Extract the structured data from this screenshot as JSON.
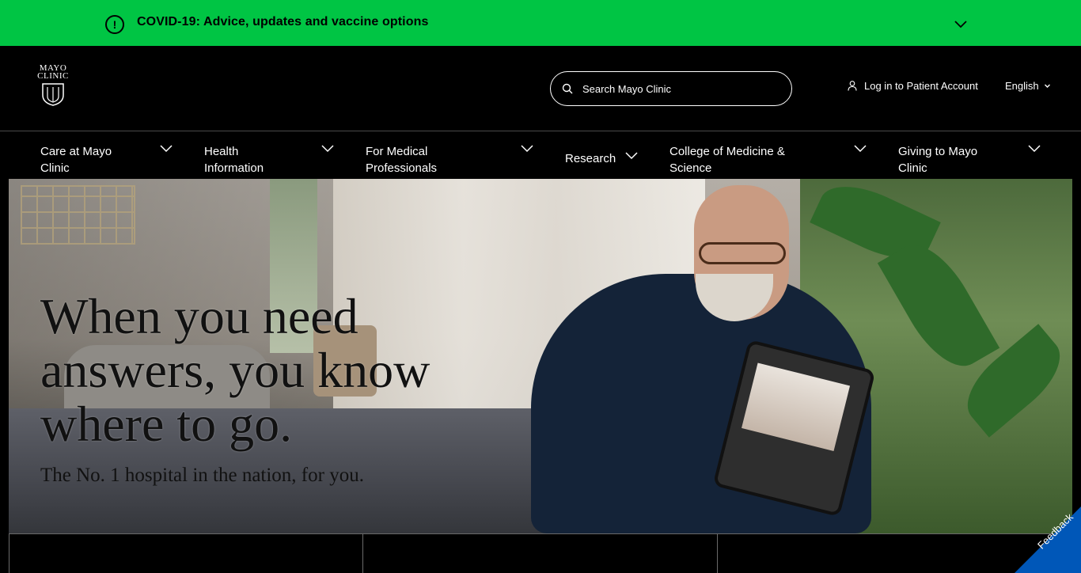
{
  "covid_banner": {
    "text": "COVID-19: Advice, updates and vaccine options",
    "alert_icon": "alert-circle-icon",
    "toggle_icon": "chevron-down-icon",
    "background": "#00c544"
  },
  "header": {
    "logo": {
      "line1": "MAYO",
      "line2": "CLINIC"
    },
    "search": {
      "placeholder": "Search Mayo Clinic",
      "icon": "search-icon"
    },
    "login_label": "Log in to Patient Account",
    "language": "English"
  },
  "nav": {
    "items": [
      {
        "label": "Care at Mayo Clinic"
      },
      {
        "label": "Health Information"
      },
      {
        "label": "For Medical Professionals"
      },
      {
        "label": "Research"
      },
      {
        "label": "College of Medicine & Science"
      },
      {
        "label": "Giving to Mayo Clinic"
      }
    ]
  },
  "hero": {
    "headline": "When you need answers, you know where to go.",
    "subhead": "The No. 1 hospital in the nation, for you."
  },
  "feedback": {
    "label": "Feedback",
    "color": "#0057b8"
  }
}
